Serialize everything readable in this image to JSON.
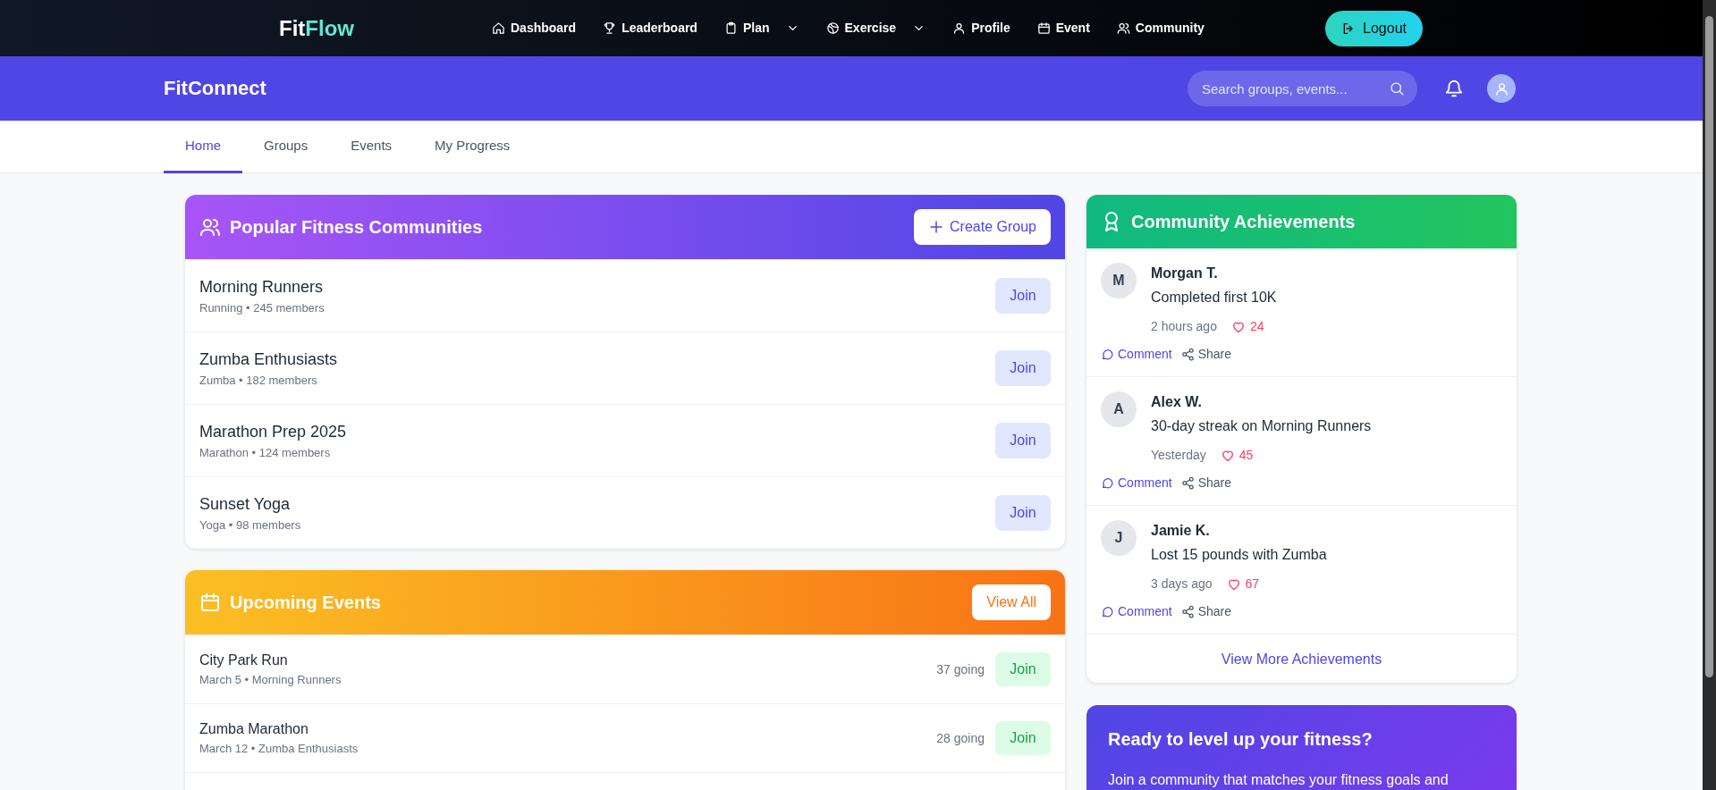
{
  "top_nav": {
    "logo_first": "Fit",
    "logo_second": "Flow",
    "items": [
      {
        "label": "Dashboard",
        "kind": "house",
        "dropdown": false
      },
      {
        "label": "Leaderboard",
        "kind": "trophy",
        "dropdown": false
      },
      {
        "label": "Plan",
        "kind": "clipboard",
        "dropdown": true
      },
      {
        "label": "Exercise",
        "kind": "ball",
        "dropdown": true
      },
      {
        "label": "Profile",
        "kind": "person",
        "dropdown": false
      },
      {
        "label": "Event",
        "kind": "calendar",
        "dropdown": false
      },
      {
        "label": "Community",
        "kind": "people",
        "dropdown": false
      }
    ],
    "logout": "Logout"
  },
  "header": {
    "title": "FitConnect",
    "search": {
      "placeholder": "Search groups, events..."
    }
  },
  "tabs": [
    {
      "label": "Home",
      "selected": true
    },
    {
      "label": "Groups",
      "selected": false
    },
    {
      "label": "Events",
      "selected": false
    },
    {
      "label": "My Progress",
      "selected": false
    }
  ],
  "communities": {
    "title": "Popular Fitness Communities",
    "button": "Create Group",
    "groups": [
      {
        "name": "Morning Runners",
        "meta": "Running • 245 members",
        "action": "Join"
      },
      {
        "name": "Zumba Enthusiasts",
        "meta": "Zumba • 182 members",
        "action": "Join"
      },
      {
        "name": "Marathon Prep 2025",
        "meta": "Marathon • 124 members",
        "action": "Join"
      },
      {
        "name": "Sunset Yoga",
        "meta": "Yoga • 98 members",
        "action": "Join"
      }
    ]
  },
  "events": {
    "title": "Upcoming Events",
    "button": "View All",
    "items": [
      {
        "name": "City Park Run",
        "meta": "March 5 • Morning Runners",
        "going": "37 going",
        "action": "Join"
      },
      {
        "name": "Zumba Marathon",
        "meta": "March 12 • Zumba Enthusiasts",
        "going": "28 going",
        "action": "Join"
      }
    ]
  },
  "achievements": {
    "title": "Community Achievements",
    "items": [
      {
        "initial": "M",
        "name": "Morgan T.",
        "text": "Completed first 10K",
        "time": "2 hours ago",
        "likes": "24",
        "comment": "Comment",
        "share": "Share"
      },
      {
        "initial": "A",
        "name": "Alex W.",
        "text": "30-day streak on Morning Runners",
        "time": "Yesterday",
        "likes": "45",
        "comment": "Comment",
        "share": "Share"
      },
      {
        "initial": "J",
        "name": "Jamie K.",
        "text": "Lost 15 pounds with Zumba",
        "time": "3 days ago",
        "likes": "67",
        "comment": "Comment",
        "share": "Share"
      }
    ],
    "footer": "View More Achievements"
  },
  "cta": {
    "title": "Ready to level up your fitness?",
    "text": "Join a community that matches your fitness goals and"
  }
}
